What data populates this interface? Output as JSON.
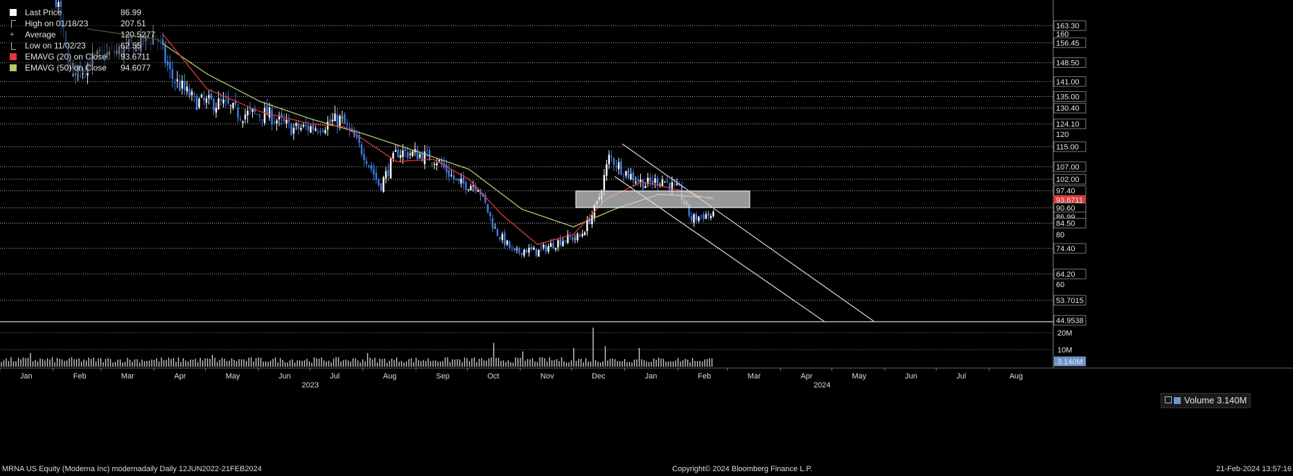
{
  "legend": {
    "items": [
      {
        "label": "Last Price",
        "value": "86.99",
        "marker": "square-white"
      },
      {
        "label": "High on 01/18/23",
        "value": "207.51",
        "marker": "high-tick"
      },
      {
        "label": "Average",
        "value": "120.5277",
        "marker": "average-plus"
      },
      {
        "label": "Low on 11/02/23",
        "value": "62.55",
        "marker": "low-tick"
      },
      {
        "label": "EMAVG (20)   on Close",
        "value": "93.6711",
        "marker": "square-red"
      },
      {
        "label": "EMAVG (50)   on Close",
        "value": "94.6077",
        "marker": "square-green"
      }
    ]
  },
  "volume_legend": {
    "label": "Volume 3.140M"
  },
  "footer": {
    "left": "MRNA US Equity (Moderna Inc) modernadaily  Daily 12JUN2022-21FEB2024",
    "center": "Copyright© 2024 Bloomberg Finance L.P.",
    "right": "21-Feb-2024 13:57:16"
  },
  "colors": {
    "background": "#000000",
    "candle_up": "#ffffff",
    "candle_down": "#3f7ee8",
    "ema20": "#e23a3a",
    "ema50": "#b7c96a",
    "volume": "#cfcfcf",
    "last_price_tag": "#e23a3a"
  },
  "chart_data": {
    "type": "candlestick",
    "y_axis_labels": [
      "163.30",
      "160",
      "156.45",
      "148.50",
      "141.00",
      "135.00",
      "130.40",
      "124.10",
      "120",
      "115.00",
      "107.00",
      "102.00",
      "97.40",
      "93.6711",
      "90.60",
      "86.99",
      "84.50",
      "80",
      "74.40",
      "64.20",
      "60",
      "53.7015",
      "44.9538"
    ],
    "dotted_levels": [
      163.3,
      156.45,
      148.5,
      141.0,
      135.0,
      130.4,
      124.1,
      115.0,
      107.0,
      102.0,
      97.4,
      90.6,
      84.5,
      74.4,
      64.2,
      53.7015
    ],
    "last_price_tag": "93.6711",
    "volume_axis_labels": [
      "20M",
      "10M",
      "3.140M"
    ],
    "x_month_labels": [
      "Jan",
      "Feb",
      "Mar",
      "Apr",
      "May",
      "Jun",
      "Jul",
      "Aug",
      "Sep",
      "Oct",
      "Nov",
      "Dec",
      "Jan",
      "Feb",
      "Mar",
      "Apr",
      "May",
      "Jun",
      "Jul",
      "Aug"
    ],
    "x_year_labels": [
      "2023",
      "2024"
    ],
    "price_waypoints": [
      {
        "date": "2023-01-03",
        "close": 182
      },
      {
        "date": "2023-01-18",
        "close": 205
      },
      {
        "date": "2023-02-01",
        "close": 176
      },
      {
        "date": "2023-02-10",
        "close": 145
      },
      {
        "date": "2023-02-24",
        "close": 150
      },
      {
        "date": "2023-03-10",
        "close": 153
      },
      {
        "date": "2023-03-24",
        "close": 156
      },
      {
        "date": "2023-04-01",
        "close": 160
      },
      {
        "date": "2023-04-10",
        "close": 143
      },
      {
        "date": "2023-04-24",
        "close": 133
      },
      {
        "date": "2023-05-10",
        "close": 132
      },
      {
        "date": "2023-05-20",
        "close": 128
      },
      {
        "date": "2023-06-05",
        "close": 128
      },
      {
        "date": "2023-06-20",
        "close": 122
      },
      {
        "date": "2023-07-05",
        "close": 123
      },
      {
        "date": "2023-07-18",
        "close": 126
      },
      {
        "date": "2023-08-01",
        "close": 112
      },
      {
        "date": "2023-08-10",
        "close": 99
      },
      {
        "date": "2023-08-20",
        "close": 113
      },
      {
        "date": "2023-09-01",
        "close": 112
      },
      {
        "date": "2023-09-12",
        "close": 110
      },
      {
        "date": "2023-09-25",
        "close": 100
      },
      {
        "date": "2023-10-06",
        "close": 100
      },
      {
        "date": "2023-10-16",
        "close": 82
      },
      {
        "date": "2023-10-28",
        "close": 72
      },
      {
        "date": "2023-11-02",
        "close": 74
      },
      {
        "date": "2023-11-10",
        "close": 73
      },
      {
        "date": "2023-11-25",
        "close": 78
      },
      {
        "date": "2023-12-05",
        "close": 79
      },
      {
        "date": "2023-12-15",
        "close": 92
      },
      {
        "date": "2023-12-22",
        "close": 111
      },
      {
        "date": "2024-01-02",
        "close": 104
      },
      {
        "date": "2024-01-12",
        "close": 100
      },
      {
        "date": "2024-01-22",
        "close": 102
      },
      {
        "date": "2024-02-01",
        "close": 97
      },
      {
        "date": "2024-02-08",
        "close": 86
      },
      {
        "date": "2024-02-16",
        "close": 88
      },
      {
        "date": "2024-02-21",
        "close": 87
      }
    ],
    "ema20": [
      {
        "date": "2023-04-05",
        "value": 160
      },
      {
        "date": "2023-05-01",
        "value": 138
      },
      {
        "date": "2023-06-01",
        "value": 129
      },
      {
        "date": "2023-07-01",
        "value": 124
      },
      {
        "date": "2023-07-20",
        "value": 123
      },
      {
        "date": "2023-08-20",
        "value": 109
      },
      {
        "date": "2023-09-10",
        "value": 110
      },
      {
        "date": "2023-10-01",
        "value": 102
      },
      {
        "date": "2023-10-20",
        "value": 88
      },
      {
        "date": "2023-11-10",
        "value": 76
      },
      {
        "date": "2023-12-01",
        "value": 80
      },
      {
        "date": "2023-12-20",
        "value": 94
      },
      {
        "date": "2024-01-10",
        "value": 101
      },
      {
        "date": "2024-01-30",
        "value": 98
      },
      {
        "date": "2024-02-21",
        "value": 93.7
      }
    ],
    "ema50": [
      {
        "date": "2023-02-20",
        "value": 162
      },
      {
        "date": "2023-04-01",
        "value": 158
      },
      {
        "date": "2023-05-01",
        "value": 144
      },
      {
        "date": "2023-06-01",
        "value": 133
      },
      {
        "date": "2023-07-01",
        "value": 126
      },
      {
        "date": "2023-08-01",
        "value": 120
      },
      {
        "date": "2023-09-01",
        "value": 113
      },
      {
        "date": "2023-10-01",
        "value": 106
      },
      {
        "date": "2023-11-01",
        "value": 90
      },
      {
        "date": "2023-12-01",
        "value": 83
      },
      {
        "date": "2023-12-25",
        "value": 90
      },
      {
        "date": "2024-01-20",
        "value": 96
      },
      {
        "date": "2024-02-21",
        "value": 94.6
      }
    ],
    "volume_millions": {
      "typical": 4,
      "spikes": [
        {
          "date": "2023-01-18",
          "value": 8
        },
        {
          "date": "2023-05-04",
          "value": 7
        },
        {
          "date": "2023-08-03",
          "value": 8
        },
        {
          "date": "2023-10-16",
          "value": 14
        },
        {
          "date": "2023-11-02",
          "value": 9
        },
        {
          "date": "2023-12-01",
          "value": 11
        },
        {
          "date": "2023-12-13",
          "value": 23
        },
        {
          "date": "2023-12-20",
          "value": 12
        },
        {
          "date": "2024-01-08",
          "value": 11
        }
      ]
    },
    "y_axis_right": true,
    "grid": "dotted horizontal"
  }
}
